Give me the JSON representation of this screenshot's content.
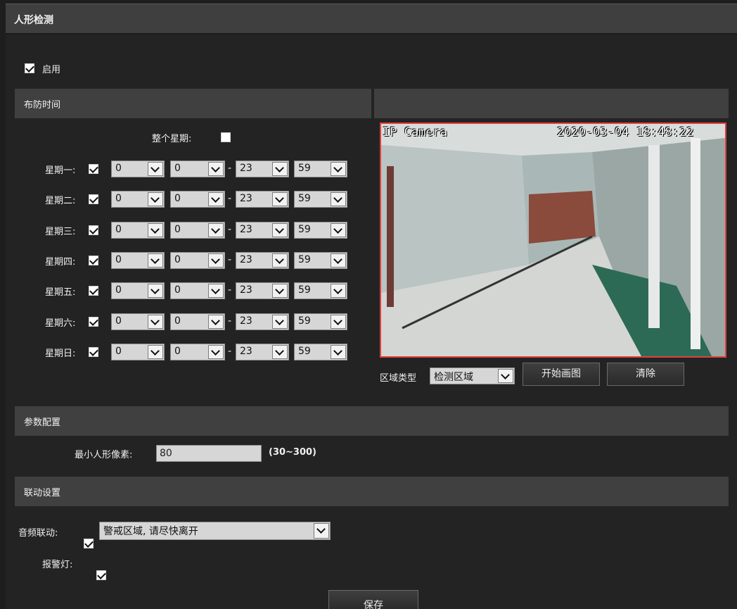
{
  "panel": {
    "title": "人形检测"
  },
  "enable": {
    "label": "启用",
    "checked": true
  },
  "schedule": {
    "section_title": "布防时间",
    "whole_week_label": "整个星期:",
    "whole_week_checked": false,
    "dash": "-",
    "days": [
      {
        "label": "星期一:",
        "checked": true,
        "start_h": "0",
        "start_m": "0",
        "end_h": "23",
        "end_m": "59"
      },
      {
        "label": "星期二:",
        "checked": true,
        "start_h": "0",
        "start_m": "0",
        "end_h": "23",
        "end_m": "59"
      },
      {
        "label": "星期三:",
        "checked": true,
        "start_h": "0",
        "start_m": "0",
        "end_h": "23",
        "end_m": "59"
      },
      {
        "label": "星期四:",
        "checked": true,
        "start_h": "0",
        "start_m": "0",
        "end_h": "23",
        "end_m": "59"
      },
      {
        "label": "星期五:",
        "checked": true,
        "start_h": "0",
        "start_m": "0",
        "end_h": "23",
        "end_m": "59"
      },
      {
        "label": "星期六:",
        "checked": true,
        "start_h": "0",
        "start_m": "0",
        "end_h": "23",
        "end_m": "59"
      },
      {
        "label": "星期日:",
        "checked": true,
        "start_h": "0",
        "start_m": "0",
        "end_h": "23",
        "end_m": "59"
      }
    ]
  },
  "video": {
    "overlay_name": "IP Camera",
    "overlay_time": "2020-03-04 18:48:22",
    "border_color": "#e04040"
  },
  "region": {
    "type_label": "区域类型",
    "type_value": "检测区域",
    "start_draw_label": "开始画图",
    "clear_label": "清除"
  },
  "params": {
    "section_title": "参数配置",
    "min_pixels_label": "最小人形像素:",
    "min_pixels_value": "80",
    "range_hint": "(30~300)"
  },
  "linkage": {
    "section_title": "联动设置",
    "audio_label": "音频联动:",
    "audio_checked": true,
    "audio_value": "警戒区域, 请尽快离开",
    "alarm_light_label": "报警灯:",
    "alarm_light_checked": true
  },
  "save_label": "保存"
}
